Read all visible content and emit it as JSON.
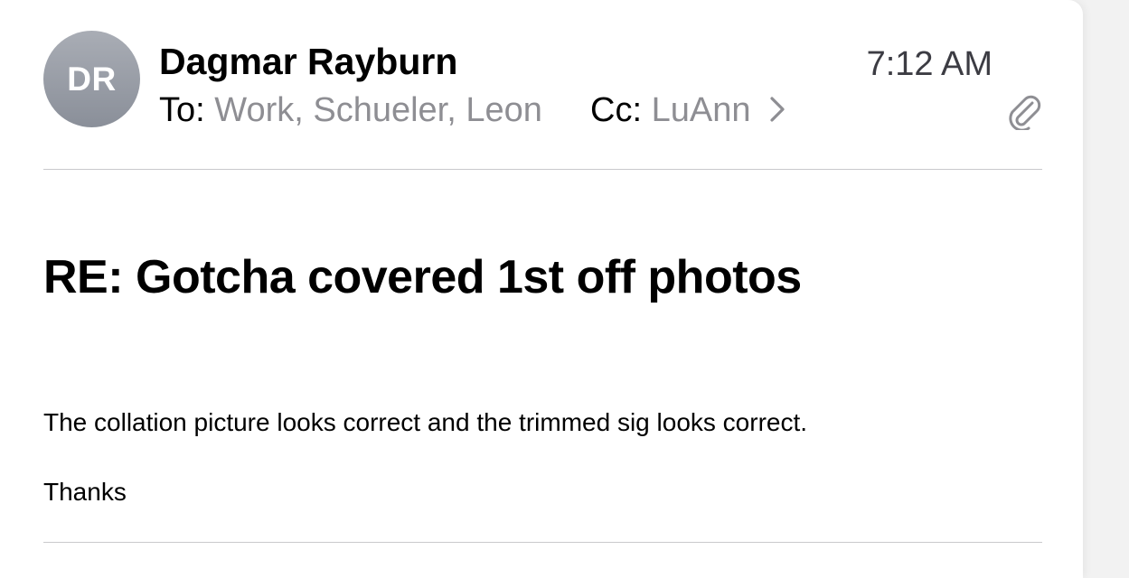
{
  "message": {
    "avatar_initials": "DR",
    "sender_name": "Dagmar Rayburn",
    "to_label": "To:",
    "to_value": "Work, Schueler, Leon",
    "cc_label": "Cc:",
    "cc_value": "LuAnn",
    "time": "7:12 AM",
    "has_attachment_icon": "paperclip-icon",
    "expand_icon": "chevron-right-icon",
    "subject": "RE: Gotcha covered 1st off photos",
    "body_lines": [
      "The collation picture looks correct and the trimmed sig looks correct.",
      "Thanks"
    ]
  },
  "colors": {
    "avatar_gray": "#9a9ea6",
    "secondary_text": "#8e8e93",
    "divider": "#c9c9cc"
  }
}
